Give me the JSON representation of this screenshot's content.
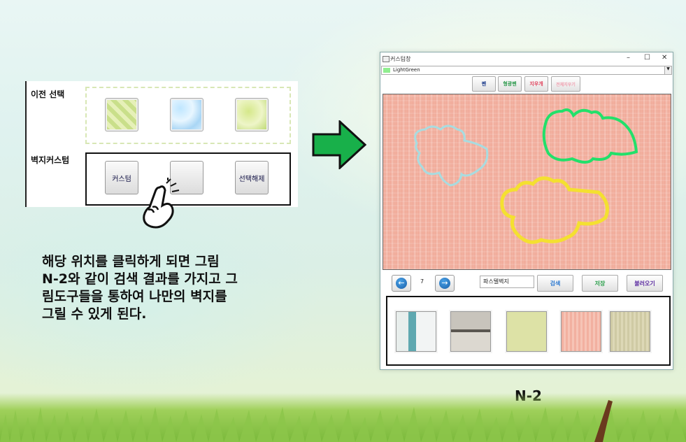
{
  "left_panel": {
    "prev_selection_label": "이전 선택",
    "wallpaper_custom_label": "벽지커스텀",
    "buttons": {
      "custom": "커스텀",
      "blank": "",
      "deselect": "선택해제"
    }
  },
  "description": "해당 위치를 클릭하게 되면 그림\nN-2와 같이 검색 결과를 가지고 그\n림도구들을 통하여 나만의 벽지를\n그릴 수 있게 된다.",
  "window": {
    "title": "커스텀창",
    "controls": {
      "minimize": "–",
      "maximize": "☐",
      "close": "✕"
    },
    "color_combo": {
      "value": "LightGreen",
      "swatch": "#90ee90"
    },
    "tools": [
      {
        "label": "펜",
        "color": "#1a3a8a"
      },
      {
        "label": "형광펜",
        "color": "#2e9a4e"
      },
      {
        "label": "지우개",
        "color": "#e0405a"
      },
      {
        "label": "전체지우기",
        "color": "#f0a0b0"
      }
    ],
    "pager": {
      "prev_icon": "arrow-left-icon",
      "page": "7",
      "next_icon": "arrow-right-icon"
    },
    "search": {
      "value": "파스텔벽지"
    },
    "actions": {
      "search": {
        "label": "검색",
        "color": "#2e7ad0"
      },
      "save": {
        "label": "저장",
        "color": "#2ea04e"
      },
      "load": {
        "label": "불러오기",
        "color": "#5a2aa0"
      }
    },
    "canvas_strokes": [
      {
        "name": "light-blue-cloud",
        "color": "#a8dce0"
      },
      {
        "name": "green-cloud",
        "color": "#22e06a"
      },
      {
        "name": "yellow-cloud",
        "color": "#f4e030"
      }
    ]
  },
  "figure_label": "N-2"
}
